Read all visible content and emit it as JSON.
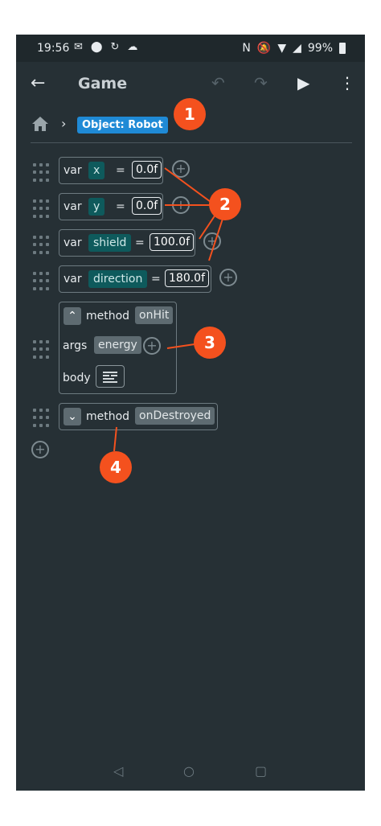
{
  "status": {
    "time": "19:56",
    "battery": "99%"
  },
  "appbar": {
    "title": "Game"
  },
  "breadcrumb": {
    "object": "Object: Robot"
  },
  "vars": [
    {
      "keyword": "var",
      "name": "x",
      "eq": "=",
      "value": "0.0f"
    },
    {
      "keyword": "var",
      "name": "y",
      "eq": "=",
      "value": "0.0f"
    },
    {
      "keyword": "var",
      "name": "shield",
      "eq": "=",
      "value": "100.0f"
    },
    {
      "keyword": "var",
      "name": "direction",
      "eq": "=",
      "value": "180.0f"
    }
  ],
  "method1": {
    "keyword": "method",
    "name": "onHit",
    "args_label": "args",
    "arg": "energy",
    "body_label": "body"
  },
  "method2": {
    "keyword": "method",
    "name": "onDestroyed"
  },
  "callouts": [
    "1",
    "2",
    "3",
    "4"
  ],
  "colors": {
    "accent": "#1f8ad6",
    "callout": "#f4511e",
    "background": "#263035"
  }
}
